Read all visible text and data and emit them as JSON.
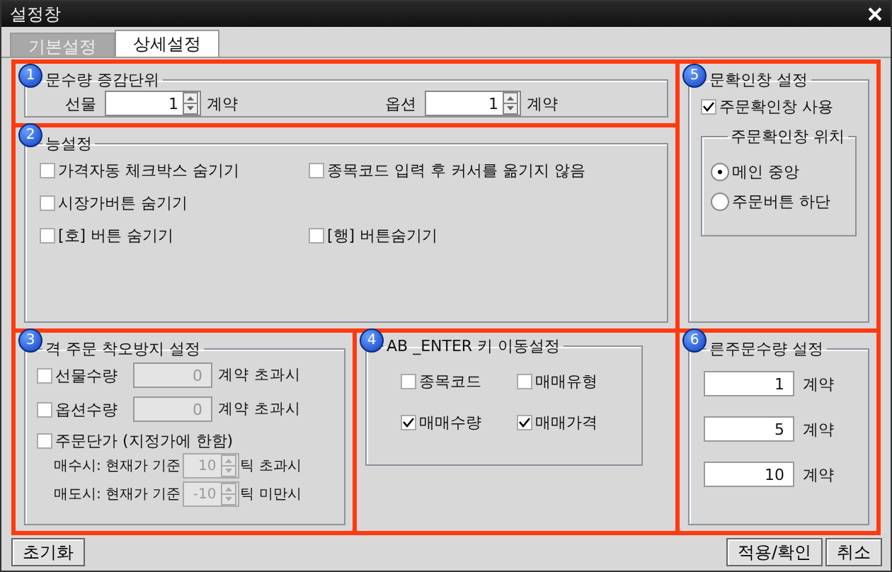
{
  "window": {
    "title": "설정창"
  },
  "tabs": [
    {
      "label": "기본설정",
      "selected": false
    },
    {
      "label": "상세설정",
      "selected": true
    }
  ],
  "qty_unit": {
    "badge": "1",
    "title": "문수량 증감단위",
    "fields": [
      {
        "label": "선물",
        "value": "1",
        "unit": "계약"
      },
      {
        "label": "옵션",
        "value": "1",
        "unit": "계약"
      }
    ]
  },
  "functions": {
    "badge": "2",
    "title": "능설정",
    "rows": [
      [
        {
          "label": "가격자동 체크박스 숨기기",
          "checked": false
        },
        {
          "label": "종목코드 입력 후 커서를 옮기지 않음",
          "checked": false
        }
      ],
      [
        {
          "label": "시장가버튼 숨기기",
          "checked": false
        }
      ],
      [
        {
          "label": "[호] 버튼 숨기기",
          "checked": false
        },
        {
          "label": "[행] 버튼숨기기",
          "checked": false
        }
      ]
    ]
  },
  "order_guard": {
    "badge": "3",
    "title": "격 주문 착오방지 설정",
    "limits": [
      {
        "label": "선물수량",
        "checked": false,
        "value": "0",
        "unit": "계약 초과시",
        "disabled": true
      },
      {
        "label": "옵션수량",
        "checked": false,
        "value": "0",
        "unit": "계약 초과시",
        "disabled": true
      }
    ],
    "price": {
      "label": "주문단가 (지정가에 한함)",
      "checked": false,
      "rows": [
        {
          "label": "매수시: 현재가 기준",
          "value": "10",
          "unit": "틱 초과시",
          "disabled": true
        },
        {
          "label": "매도시: 현재가 기준",
          "value": "-10",
          "unit": "틱 미만시",
          "disabled": true
        }
      ]
    }
  },
  "tab_enter": {
    "badge": "4",
    "title": "AB _ENTER 키 이동설정",
    "options": [
      {
        "label": "종목코드",
        "checked": false
      },
      {
        "label": "매매유형",
        "checked": false
      },
      {
        "label": "매매수량",
        "checked": true
      },
      {
        "label": "매매가격",
        "checked": true
      }
    ]
  },
  "confirm": {
    "badge": "5",
    "title": "문확인창 설정",
    "use": {
      "label": "주문확인창 사용",
      "checked": true
    },
    "position": {
      "title": "주문확인창 위치",
      "options": [
        {
          "label": "메인 중앙",
          "selected": true
        },
        {
          "label": "주문버튼 하단",
          "selected": false
        }
      ]
    }
  },
  "quick_qty": {
    "badge": "6",
    "title": "른주문수량 설정",
    "rows": [
      {
        "value": "1",
        "unit": "계약"
      },
      {
        "value": "5",
        "unit": "계약"
      },
      {
        "value": "10",
        "unit": "계약"
      }
    ]
  },
  "buttons": {
    "reset": "초기화",
    "apply": "적용/확인",
    "cancel": "취소"
  }
}
